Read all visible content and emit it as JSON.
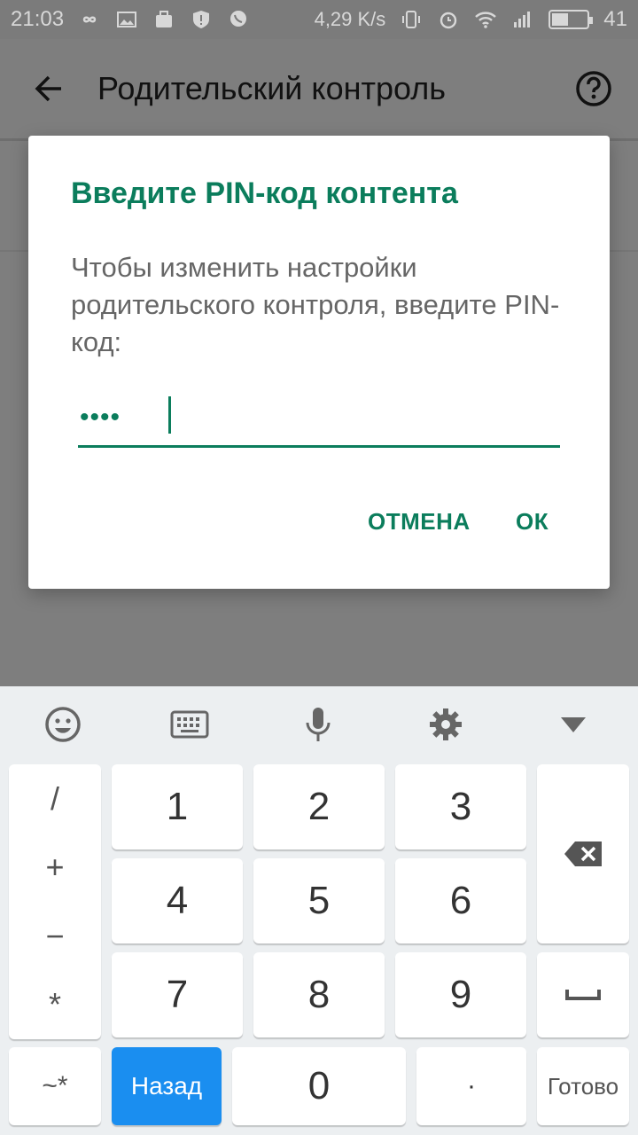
{
  "status_bar": {
    "time": "21:03",
    "speed": "4,29 K/s",
    "battery": "41"
  },
  "app_bar": {
    "title": "Родительский контроль",
    "back_icon": "arrow-left-icon",
    "help_icon": "help-circle-icon"
  },
  "dialog": {
    "title": "Введите PIN-код контента",
    "message": "Чтобы изменить настройки родительского контроля, введите PIN-код:",
    "pin_value": "••••",
    "cancel_label": "ОТМЕНА",
    "ok_label": "ОК"
  },
  "keyboard": {
    "toolbar_icons": [
      "emoji-icon",
      "keyboard-icon",
      "microphone-icon",
      "settings-icon",
      "collapse-icon"
    ],
    "side_symbols": [
      "/",
      "+",
      "−",
      "*"
    ],
    "digits": [
      "1",
      "2",
      "3",
      "4",
      "5",
      "6",
      "7",
      "8",
      "9",
      "0"
    ],
    "symbols_key": "~*",
    "back_key": "Назад",
    "dot_key": "·",
    "done_key": "Готово",
    "accent_color": "#1a8ef0"
  },
  "colors": {
    "accent": "#0b7d5c",
    "scrim": "#7e7e7e"
  }
}
